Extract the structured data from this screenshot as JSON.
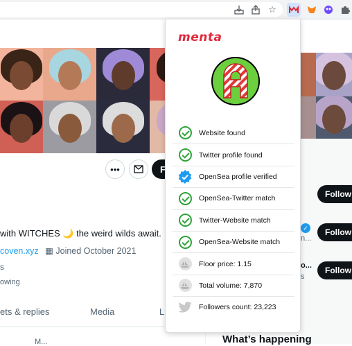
{
  "browser": {
    "extensions": [
      "download-icon",
      "share-icon",
      "bookmark-star-icon",
      "menta-extension-icon",
      "metamask-fox-icon",
      "purple-extension-icon",
      "puzzle-extensions-icon"
    ]
  },
  "profile": {
    "bio_tail": "with WITCHES 🌙 the weird wilds await.",
    "link_text": "coven.xyz",
    "joined_text": "Joined October 2021",
    "stat_following_tail": "s",
    "stat_followers_tail": "owing",
    "follow_label_partial": "F"
  },
  "tabs": [
    {
      "label": "ets & replies"
    },
    {
      "label": "Media"
    },
    {
      "label": "Li"
    }
  ],
  "sidebar": {
    "follow_labels": [
      "Follow",
      "Follow",
      "Follow"
    ],
    "snippets": [
      "n...",
      "o...",
      "s"
    ],
    "whats_happening": "What’s happening",
    "bottom_snippet": "M..."
  },
  "popup": {
    "brand": "menta",
    "checks": [
      {
        "label": "Website found",
        "status": "check"
      },
      {
        "label": "Twitter profile found",
        "status": "check"
      },
      {
        "label": "OpenSea profile verified",
        "status": "verified"
      },
      {
        "label": "OpenSea-Twitter match",
        "status": "check"
      },
      {
        "label": "Twitter-Website match",
        "status": "check"
      },
      {
        "label": "OpenSea-Website match",
        "status": "check"
      }
    ],
    "stats": [
      {
        "label": "Floor price: 1.15",
        "icon": "opensea-boat-icon"
      },
      {
        "label": "Total volume: 7,870",
        "icon": "opensea-boat-icon"
      },
      {
        "label": "Followers count: 23,223",
        "icon": "twitter-bird-icon"
      }
    ]
  },
  "colors": {
    "check_green": "#2fa33a",
    "verified_blue": "#1d9bf0",
    "brand_red": "#e0293c",
    "avatar_green": "#6ccf3e",
    "twitter_link": "#1d9bf0"
  }
}
